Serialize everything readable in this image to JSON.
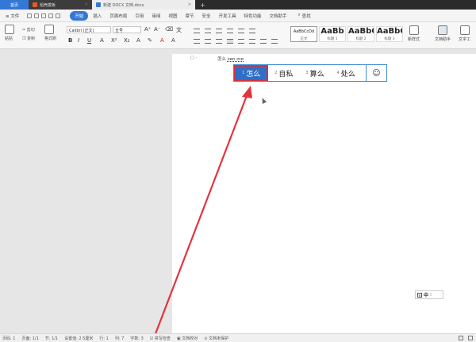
{
  "tabs": {
    "home": "首页",
    "template": "稻壳模板",
    "document": "新建 DOCX 文档.docx",
    "plus": "+"
  },
  "menu": {
    "file": "文件",
    "items": [
      "开始",
      "插入",
      "页面布局",
      "引用",
      "审阅",
      "视图",
      "章节",
      "安全",
      "开发工具",
      "特色功能",
      "文档助手"
    ],
    "search": "查找"
  },
  "toolbar": {
    "paste": "粘贴",
    "cut": "剪切",
    "copy": "复制",
    "format_painter": "格式刷",
    "font_name": "Calibri (正文)",
    "font_size": "五号",
    "styles": [
      {
        "sample": "AaBbCcDd",
        "name": "正文"
      },
      {
        "sample": "AaBb",
        "name": "标题 1"
      },
      {
        "sample": "AaBbC",
        "name": "标题 2"
      },
      {
        "sample": "AaBbC",
        "name": "标题 3"
      }
    ],
    "new_style": "新样式",
    "doc_assistant": "文档助手",
    "text_tool": "文字工"
  },
  "document": {
    "typed": "怎么",
    "pinyin": "zen me"
  },
  "ime": {
    "candidates": [
      {
        "num": "1",
        "text": "怎么"
      },
      {
        "num": "2",
        "text": "自私"
      },
      {
        "num": "3",
        "text": "算么"
      },
      {
        "num": "4",
        "text": "处么"
      }
    ],
    "emoji": "☺",
    "status_lang": "中"
  },
  "status": {
    "page": "页码: 1",
    "pages": "页面: 1/1",
    "section": "节: 1/1",
    "setting": "设置值: 2.5厘米",
    "row": "行: 1",
    "col": "列: 7",
    "chars": "字数: 3",
    "spell": "拼写检查",
    "proof": "文档校对",
    "unprotected": "文档未保护"
  },
  "colors": {
    "accent": "#3478d6",
    "annotation": "#e2343d",
    "candidate_selected": "#2f6fc7"
  }
}
